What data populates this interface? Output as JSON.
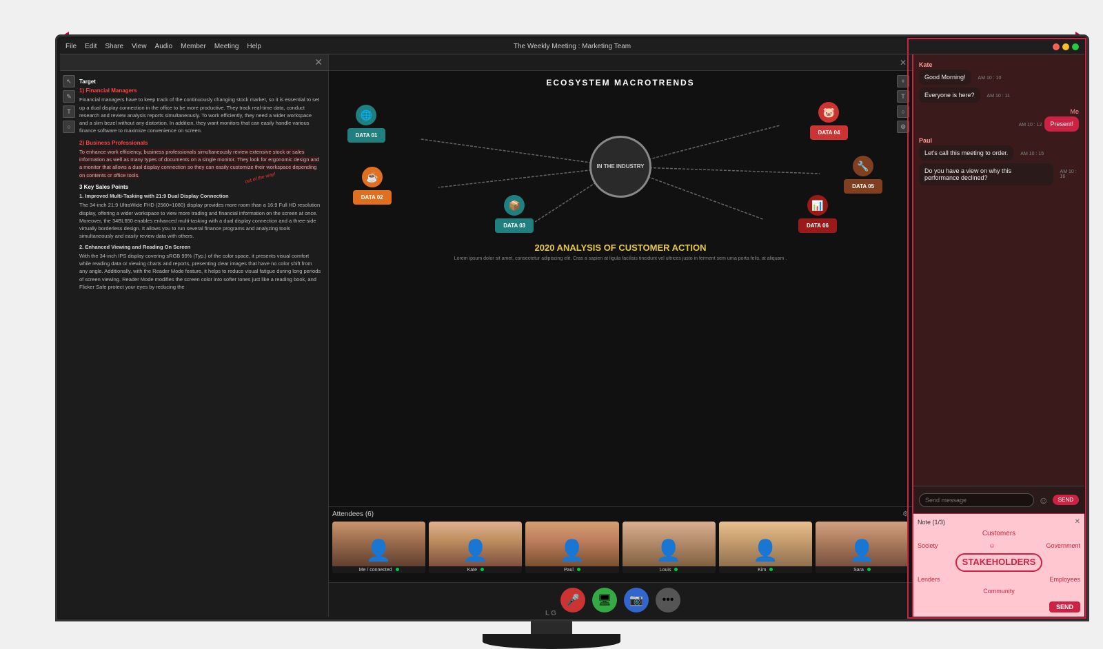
{
  "page": {
    "bg_color": "#e8e8e8"
  },
  "dimension_arrow": {
    "visible": true
  },
  "monitor": {
    "brand": "LG",
    "title_bar": {
      "title": "The Weekly Meeting : Marketing Team",
      "menu_items": [
        "File",
        "Edit",
        "Share",
        "View",
        "Audio",
        "Member",
        "Meeting",
        "Help"
      ]
    }
  },
  "left_panel": {
    "doc_title": "Target",
    "sections": [
      {
        "heading": "1) Financial Managers",
        "body": "Financial managers have to keep track of the continuously changing stock market, so it is essential to set up a dual display connection in the office to be more productive. They track real-time data, conduct research and review analysis reports simultaneously. To work efficiently, they need a wider workspace and a slim bezel without any distortion. In addition, they want monitors that can easily handle various finance software to maximize convenience on screen."
      },
      {
        "heading": "2) Business Professionals",
        "body": "To enhance work efficiency, business professionals simultaneously review extensive stock or sales information as well as many types of documents on a single monitor. They look for ergonomic design and a monitor that allows a dual display connection so they can easily customize their workspace depending on contents or office tools."
      },
      {
        "heading": "3 Key Sales Points",
        "sub_heading": "1. Improved Multi-Tasking with 21:9 Dual Display Connection",
        "body2": "The 34-inch 21:9 UltraWide FHD (2560×1080) display provides more room than a 16:9 Full HD resolution display, offering a wider workspace to view more trading and financial information on the screen at once. Moreover, the 34BL650 enables enhanced multi-tasking with a dual display connection and a three-side virtually borderless design. It allows you to run several finance programs and analyzing tools simultaneously and easily review data with others.",
        "sub_heading2": "2. Enhanced Viewing and Reading On Screen",
        "body3": "With the 34-inch IPS display covering sRGB 99% (Typ.) of the color space, it presents visual comfort while reading data or viewing charts and reports, presenting clear images that have no color shift from any angle. Additionally, with the Reader Mode feature, it helps to reduce visual fatigue during long periods of screen viewing. Reader Mode modifies the screen color into softer tones just like a reading book, and Flicker Safe protect your eyes by reducing the"
      }
    ],
    "handwriting": "out of the way!"
  },
  "center_panel": {
    "slide_title": "ECOSYSTEM MACROTRENDS",
    "center_circle": "IN THE INDUSTRY",
    "data_nodes": [
      {
        "label": "DATA 01",
        "color": "orange",
        "icon": "🌐",
        "position": "left"
      },
      {
        "label": "DATA 02",
        "color": "orange",
        "icon": "☕",
        "position": "left-center"
      },
      {
        "label": "DATA 03",
        "color": "teal",
        "icon": "📦",
        "position": "bottom"
      },
      {
        "label": "DATA 04",
        "color": "red",
        "icon": "🐷",
        "position": "top-right"
      },
      {
        "label": "DATA 05",
        "color": "brown",
        "icon": "🔧",
        "position": "right"
      },
      {
        "label": "DATA 06",
        "color": "dark-red",
        "icon": "📊",
        "position": "bottom-right"
      }
    ],
    "analysis_title": "2020 ANALYSIS OF CUSTOMER ACTION",
    "lorem_text": "Lorem ipsum dolor sit amet, consectetur adipiscing elit. Cras a sapien at ligula facilisis tincidunt vel ultrices justo in ferment sem urna porta felis, at aliquam ."
  },
  "attendees": {
    "title": "Attendees (6)",
    "participants": [
      {
        "name": "Me / connected",
        "connected": true
      },
      {
        "name": "Kate",
        "connected": true
      },
      {
        "name": "Paul",
        "connected": true
      },
      {
        "name": "Louis",
        "connected": true
      },
      {
        "name": "Kim",
        "connected": true
      },
      {
        "name": "Sara",
        "connected": true
      }
    ]
  },
  "chat": {
    "sender1": "Kate",
    "msg1": "Good Morning!",
    "time1": "AM 10 : 10",
    "msg2": "Everyone is here?",
    "time2": "AM 10 : 11",
    "sender_me": "Me",
    "msg3": "Present!",
    "time3": "AM 10 : 12",
    "sender2": "Paul",
    "msg4": "Let's call this meeting to order.",
    "time4": "AM 10 : 15",
    "msg5": "Do you have a view on why this performance declined?",
    "time5": "AM 10 : 16",
    "input_placeholder": "Send message",
    "send_label": "SEND"
  },
  "note": {
    "title": "Note (1/3)",
    "content_lines": [
      "Customers",
      "Society   Government",
      "STAKEHOLDERS",
      "Lenders   Employees",
      "Community"
    ],
    "send_label": "SEND",
    "smiley": "☺"
  },
  "toolbar": {
    "mic_label": "🎤",
    "screen_label": "🖥",
    "camera_label": "📷",
    "more_label": "•••"
  }
}
